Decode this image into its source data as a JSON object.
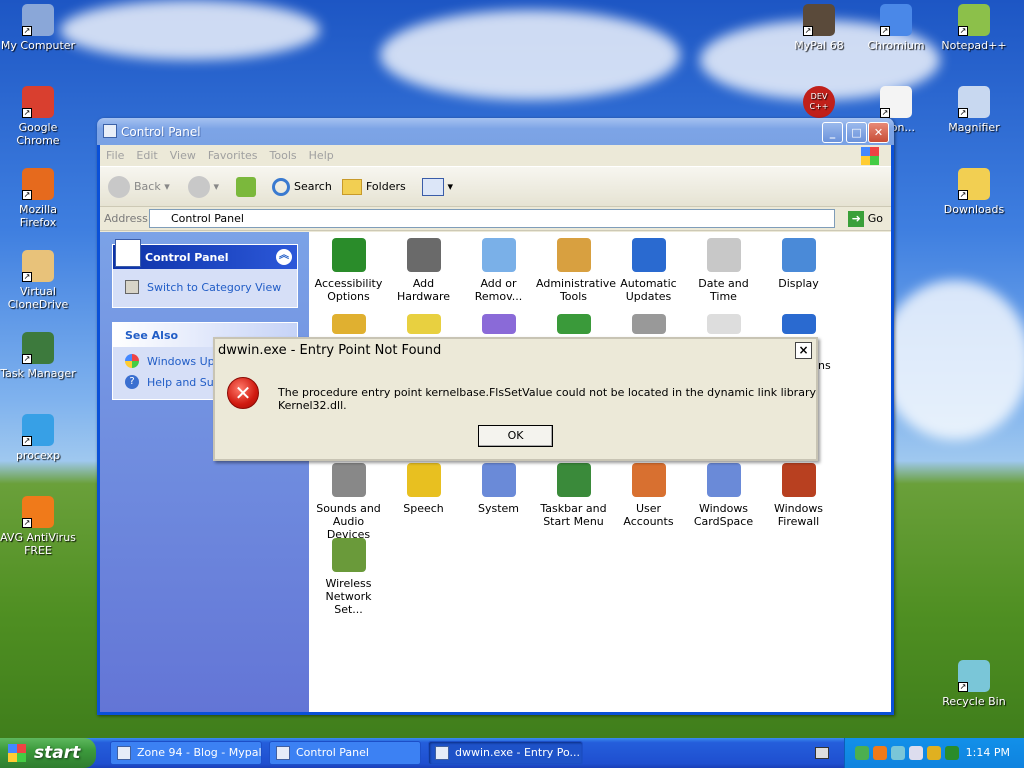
{
  "desktop": {
    "icons_left": [
      {
        "label": "My Computer",
        "icon": "my-computer-icon",
        "color": "#8aa7d8"
      },
      {
        "label": "Google Chrome",
        "icon": "chrome-icon",
        "color": "#d93f2f"
      },
      {
        "label": "Mozilla Firefox",
        "icon": "firefox-icon",
        "color": "#e66a1d"
      },
      {
        "label": "Virtual CloneDrive",
        "icon": "clonedrive-icon",
        "color": "#e8c27a"
      },
      {
        "label": "Task Manager",
        "icon": "task-manager-icon",
        "color": "#3d7a3d"
      },
      {
        "label": "procexp",
        "icon": "procexp-icon",
        "color": "#37a0e6"
      },
      {
        "label": "AVG AntiVirus FREE",
        "icon": "avg-icon",
        "color": "#f07a1a"
      }
    ],
    "icons_right": [
      {
        "label": "MyPal 68",
        "icon": "mypal-icon",
        "color": "#5a4a3a"
      },
      {
        "label": "Chromium",
        "icon": "chromium-icon",
        "color": "#4a88e8"
      },
      {
        "label": "Notepad++",
        "icon": "notepadpp-icon",
        "color": "#8cc04a"
      },
      {
        "label": "agon...",
        "icon": "document-icon",
        "color": "#f4f4f4"
      },
      {
        "label": "Magnifier",
        "icon": "magnifier-icon",
        "color": "#c8d8f0"
      },
      {
        "label": "Downloads",
        "icon": "folder-icon",
        "color": "#f2cf52"
      },
      {
        "label": "Recycle Bin",
        "icon": "recycle-bin-icon",
        "color": "#7ac6d8"
      }
    ],
    "devcpp_label": "DEV C++"
  },
  "window": {
    "title": "Control Panel",
    "menu": [
      "File",
      "Edit",
      "View",
      "Favorites",
      "Tools",
      "Help"
    ],
    "toolbar": {
      "back": "Back",
      "search": "Search",
      "folders": "Folders"
    },
    "address_label": "Address",
    "address_value": "Control Panel",
    "go_label": "Go",
    "left_pane": {
      "panel_title": "Control Panel",
      "switch_link": "Switch to Category View",
      "see_also_title": "See Also",
      "see_also_items": [
        "Windows Upd",
        "Help and Supp"
      ]
    },
    "items_row1": [
      "Accessibility Options",
      "Add Hardware",
      "Add or Remov...",
      "Administrative Tools",
      "Automatic Updates",
      "Date and Time",
      "Display"
    ],
    "items_row2_partial": "ns",
    "items_row4": [
      "Sounds and Audio Devices",
      "Speech",
      "System",
      "Taskbar and Start Menu",
      "User Accounts",
      "Windows CardSpace",
      "Windows Firewall"
    ],
    "items_row5": [
      "Wireless Network Set..."
    ]
  },
  "dialog": {
    "title": "dwwin.exe - Entry Point Not Found",
    "message": "The procedure entry point kernelbase.FlsSetValue could not be located in the dynamic link library Kernel32.dll.",
    "ok_label": "OK",
    "close_label": "×",
    "error_glyph": "✕"
  },
  "taskbar": {
    "start_label": "start",
    "tasks": [
      "Zone 94 - Blog - Mypal",
      "Control Panel",
      "dwwin.exe - Entry Po..."
    ],
    "time": "1:14 PM"
  }
}
